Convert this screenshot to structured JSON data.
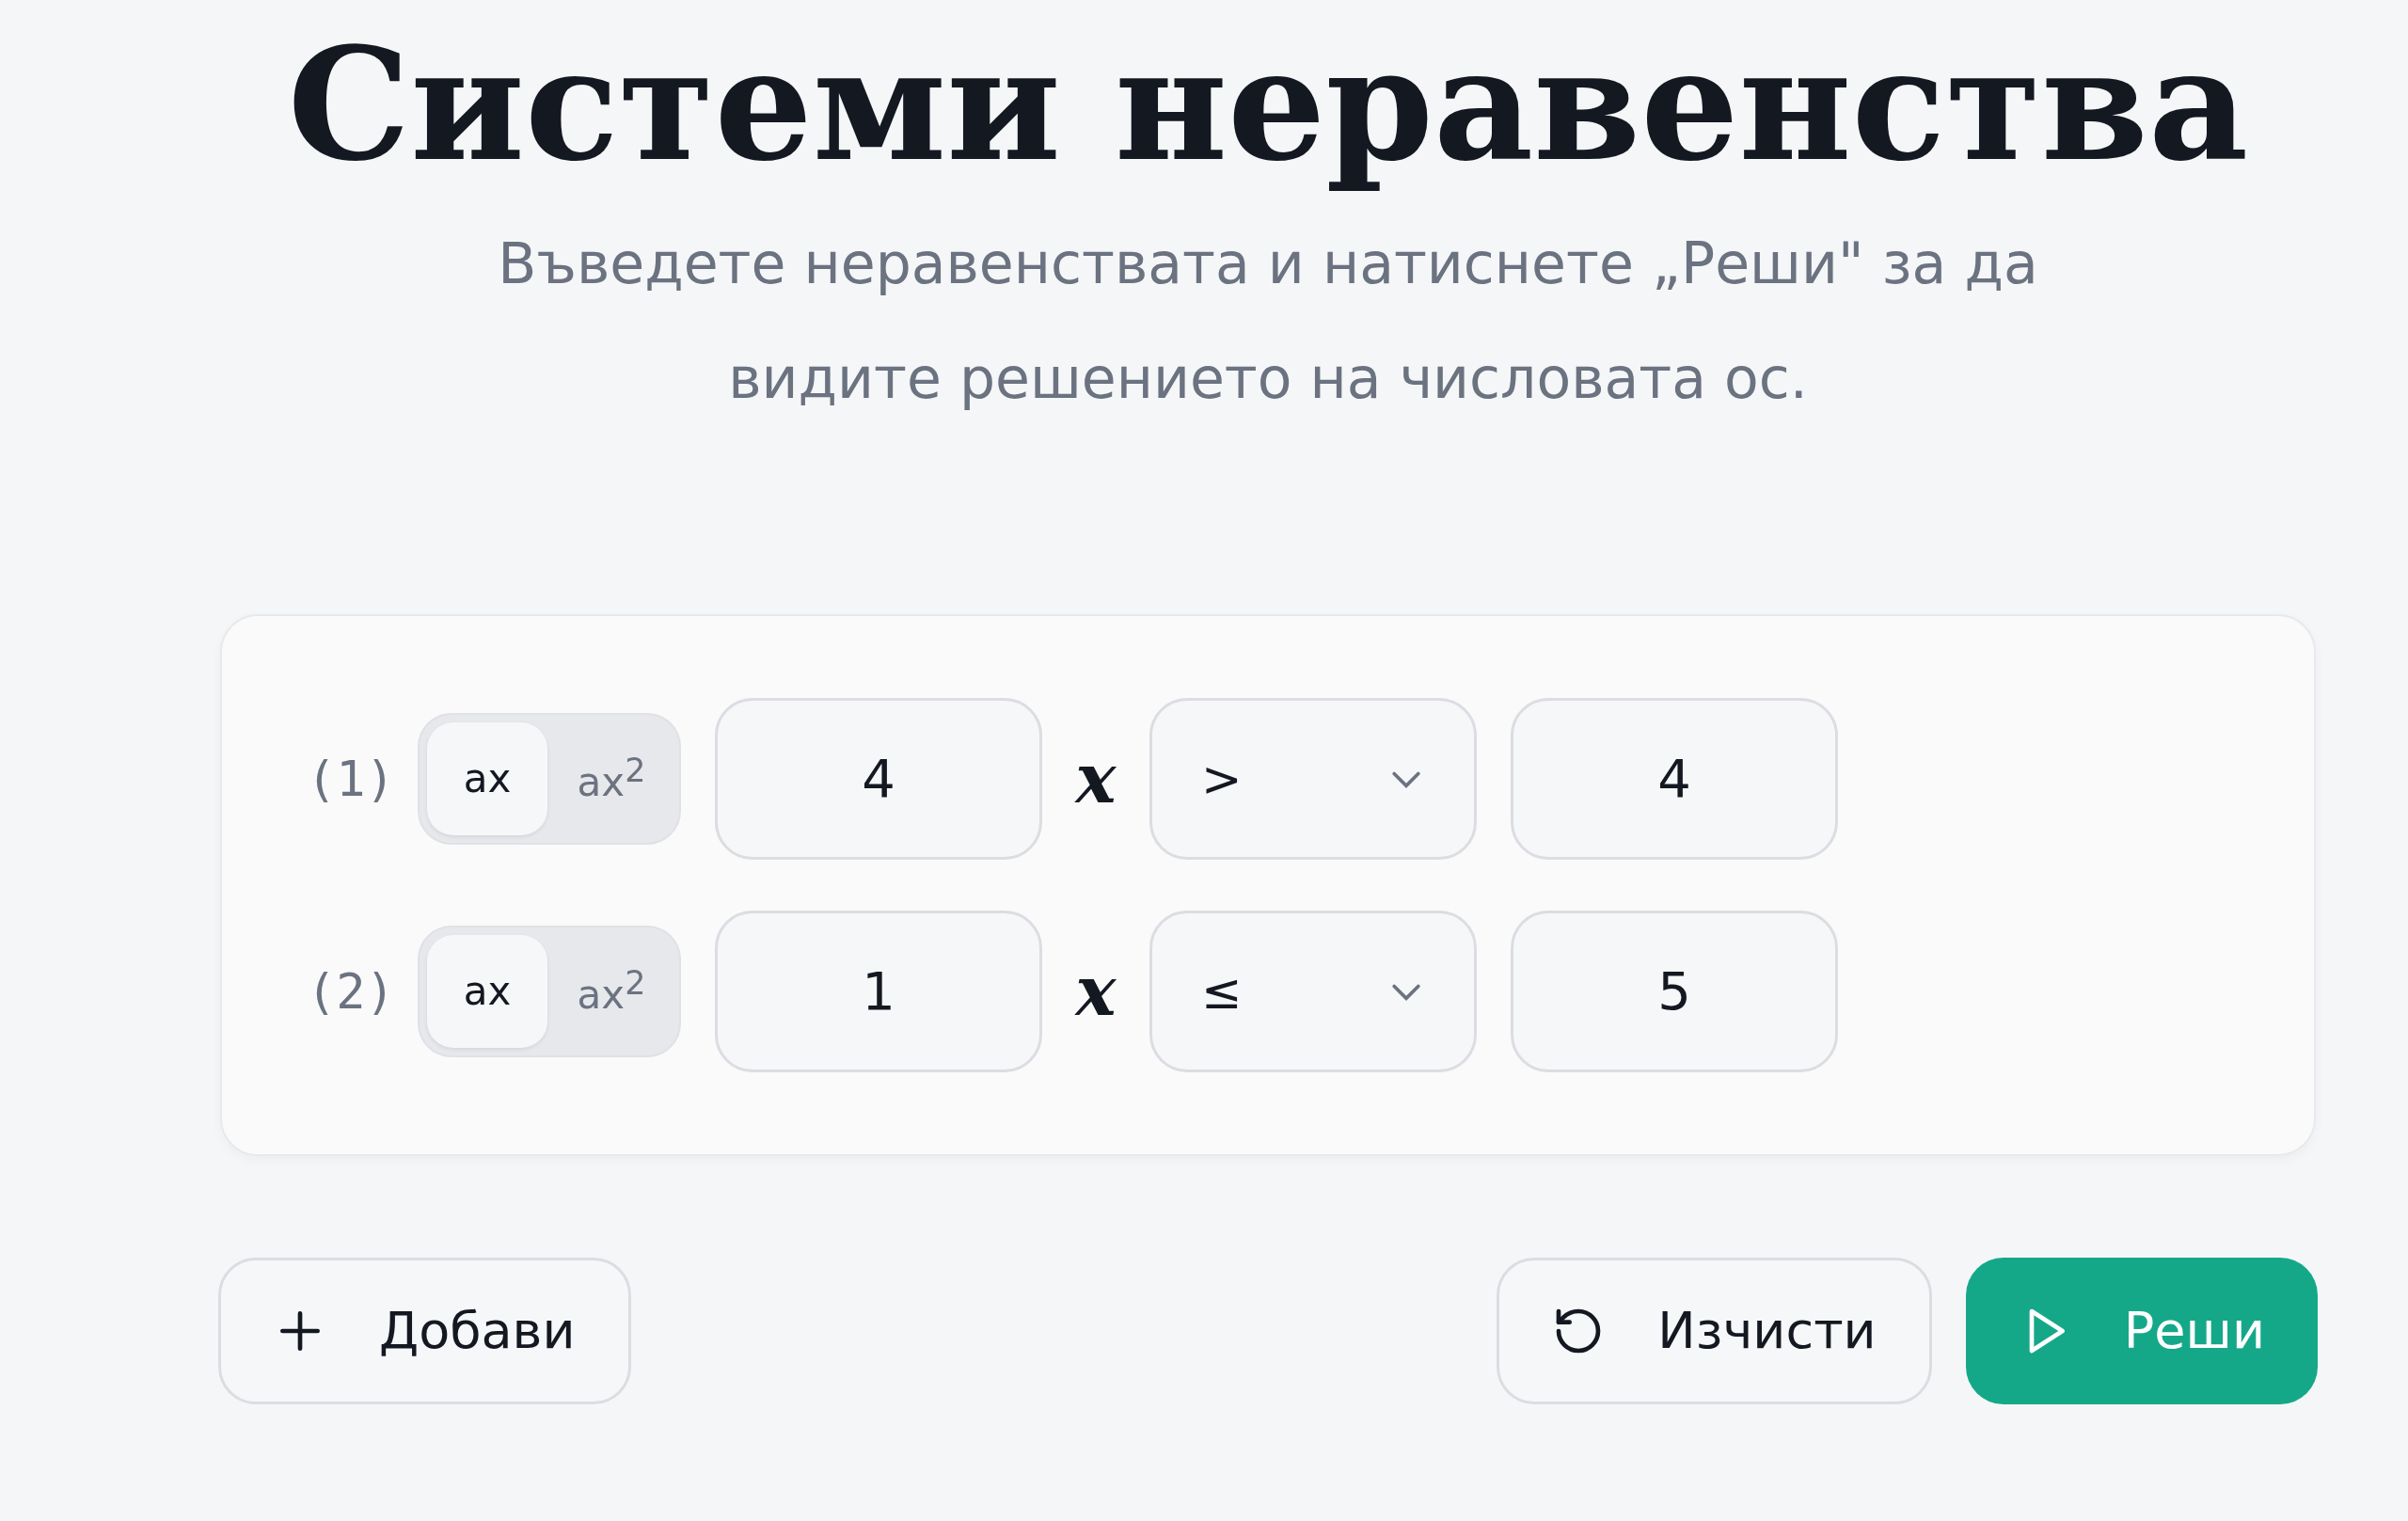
{
  "title": "Системи неравенства",
  "subtitle": "Въведете неравенствата и натиснете „Реши\" за да видите решението на числовата ос.",
  "rows": [
    {
      "index": "(1)",
      "modes": [
        {
          "label": "ax",
          "selected": true
        },
        {
          "label": "ax$^{2}$",
          "selected": false
        }
      ],
      "coefficient": "4",
      "variable": "x",
      "operator": ">",
      "value": "4"
    },
    {
      "index": "(2)",
      "modes": [
        {
          "label": "ax",
          "selected": true
        },
        {
          "label": "ax$^{2}$",
          "selected": false
        }
      ],
      "coefficient": "1",
      "variable": "x",
      "operator": "≤",
      "value": "5"
    }
  ],
  "actions": [
    {
      "kind": "add",
      "label": "Добави"
    },
    {
      "kind": "clear",
      "label": "Изчисти"
    },
    {
      "kind": "solve",
      "label": "Реши"
    }
  ]
}
